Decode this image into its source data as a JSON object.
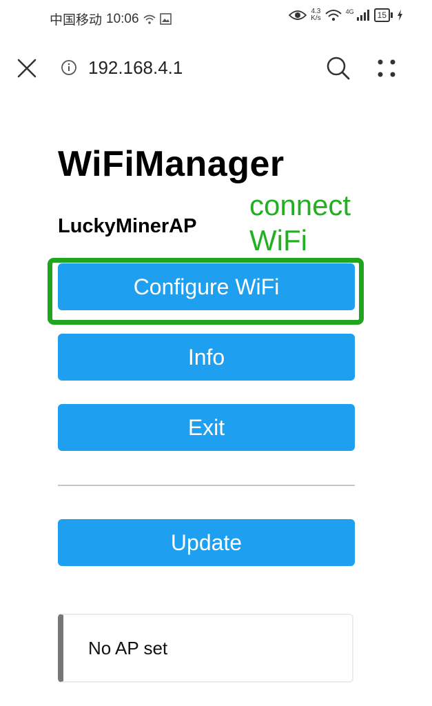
{
  "status_bar": {
    "carrier": "中国移动",
    "time": "10:06",
    "net_speed_value": "4.3",
    "net_speed_unit": "K/s",
    "signal_badge": "4G",
    "battery_level": "15"
  },
  "url_bar": {
    "url": "192.168.4.1",
    "icons": [
      "close-icon",
      "info-icon",
      "search-icon",
      "menu-icon"
    ]
  },
  "page": {
    "title": "WiFiManager",
    "ap_name": "LuckyMinerAP",
    "annotation_line1": "connect",
    "annotation_line2": "WiFi",
    "buttons": {
      "configure": "Configure WiFi",
      "info": "Info",
      "exit": "Exit",
      "update": "Update"
    },
    "message": "No AP set"
  },
  "colors": {
    "button_bg": "#1e9ff0",
    "annotation": "#21b021",
    "highlight_border": "#21a521"
  }
}
